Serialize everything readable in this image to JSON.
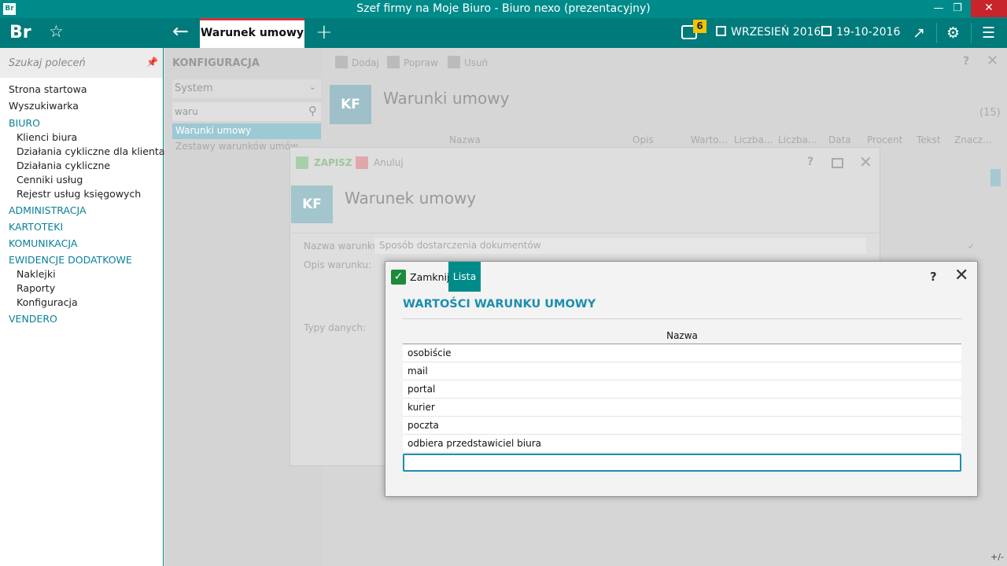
{
  "window": {
    "app_icon": "Br",
    "title": "Szef firmy na Moje Biuro - Biuro nexo (prezentacyjny)",
    "minimize_icon": "minimize-icon",
    "maximize_icon": "maximize-icon",
    "close_icon": "close-icon"
  },
  "header": {
    "brand": "Br",
    "active_tab": "Warunek umowy",
    "notifications_count": "6",
    "period": "WRZESIEŃ 2016",
    "date": "19-10-2016",
    "accent_color": "#007a7a",
    "tab_accent": "#d1343f"
  },
  "sidebar": {
    "search_placeholder": "Szukaj poleceń",
    "items": [
      {
        "type": "top",
        "label": "Strona startowa"
      },
      {
        "type": "top",
        "label": "Wyszukiwarka"
      },
      {
        "type": "cat",
        "label": "BIURO"
      },
      {
        "type": "sub",
        "label": "Klienci biura"
      },
      {
        "type": "sub",
        "label": "Działania cykliczne dla klienta"
      },
      {
        "type": "sub",
        "label": "Działania cykliczne"
      },
      {
        "type": "sub",
        "label": "Cenniki usług"
      },
      {
        "type": "sub",
        "label": "Rejestr usług księgowych"
      },
      {
        "type": "cat",
        "label": "ADMINISTRACJA"
      },
      {
        "type": "cat",
        "label": "KARTOTEKI"
      },
      {
        "type": "cat",
        "label": "KOMUNIKACJA"
      },
      {
        "type": "cat",
        "label": "EWIDENCJE DODATKOWE"
      },
      {
        "type": "sub",
        "label": "Naklejki"
      },
      {
        "type": "sub",
        "label": "Raporty"
      },
      {
        "type": "sub",
        "label": "Konfiguracja"
      },
      {
        "type": "cat",
        "label": "VENDERO"
      }
    ]
  },
  "konfiguracja": {
    "title": "KONFIGURACJA",
    "select_value": "System",
    "search_value": "waru",
    "items": [
      "Warunki umowy",
      "Zestawy warunków umów"
    ]
  },
  "list_panel": {
    "toolbar": {
      "add": "Dodaj",
      "edit": "Popraw",
      "delete": "Usuń"
    },
    "avatar": "KF",
    "title": "Warunki umowy",
    "count": "(15)",
    "columns": [
      "Nazwa",
      "Opis",
      "Warto...",
      "Liczba...",
      "Liczba...",
      "Data",
      "Procent",
      "Tekst",
      "Znacz..."
    ],
    "corner": "+/-"
  },
  "edit_dialog": {
    "save": "ZAPISZ",
    "cancel": "Anuluj",
    "avatar": "KF",
    "title": "Warunek umowy",
    "name_label": "Nazwa warunku:",
    "name_value": "Sposób dostarczenia dokumentów",
    "desc_label": "Opis warunku:",
    "types_label": "Typy danych:"
  },
  "values_dialog": {
    "close": "Zamknij",
    "tab": "Lista",
    "heading": "WARTOŚCI WARUNKU UMOWY",
    "column": "Nazwa",
    "rows": [
      "osobiście",
      "mail",
      "portal",
      "kurier",
      "poczta",
      "odbiera przedstawiciel biura"
    ],
    "new_row_value": ""
  }
}
